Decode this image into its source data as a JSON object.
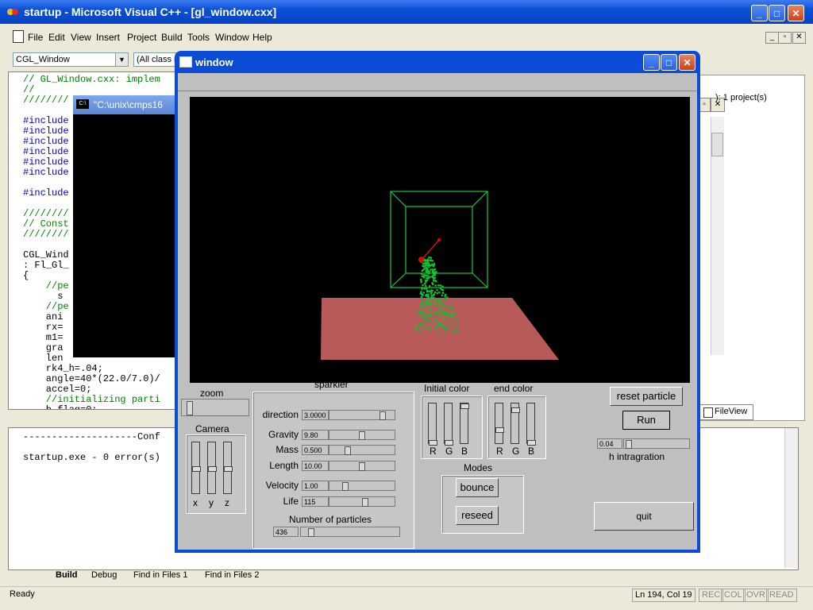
{
  "vc": {
    "title": "startup - Microsoft Visual C++ - [gl_window.cxx]",
    "menu": [
      "File",
      "Edit",
      "View",
      "Insert",
      "Project",
      "Build",
      "Tools",
      "Window",
      "Help"
    ],
    "class_combo": "CGL_Window",
    "member_combo": "(All class m",
    "code_lines": [
      {
        "text": "// GL_Window.cxx: implem",
        "color": "#008000"
      },
      {
        "text": "//",
        "color": "#008000"
      },
      {
        "text": "////////",
        "color": "#008000"
      },
      {
        "text": "",
        "color": "#000"
      },
      {
        "text": "#include",
        "color": "#0000c0"
      },
      {
        "text": "#include",
        "color": "#0000c0"
      },
      {
        "text": "#include",
        "color": "#0000c0"
      },
      {
        "text": "#include",
        "color": "#0000c0"
      },
      {
        "text": "#include",
        "color": "#0000c0"
      },
      {
        "text": "#include",
        "color": "#0000c0"
      },
      {
        "text": "",
        "color": "#000"
      },
      {
        "text": "#include",
        "color": "#0000c0"
      },
      {
        "text": "",
        "color": "#000"
      },
      {
        "text": "////////",
        "color": "#008000"
      },
      {
        "text": "// Const",
        "color": "#008000"
      },
      {
        "text": "////////",
        "color": "#008000"
      },
      {
        "text": "",
        "color": "#000"
      },
      {
        "text": "CGL_Wind",
        "color": "#000"
      },
      {
        "text": ": Fl_Gl_",
        "color": "#000"
      },
      {
        "text": "{",
        "color": "#000"
      },
      {
        "text": "    //pe",
        "color": "#008000"
      },
      {
        "text": "      s",
        "color": "#000"
      },
      {
        "text": "    //pe",
        "color": "#008000"
      },
      {
        "text": "    ani",
        "color": "#000"
      },
      {
        "text": "    rx=",
        "color": "#000"
      },
      {
        "text": "    m1=",
        "color": "#000"
      },
      {
        "text": "    gra",
        "color": "#000"
      },
      {
        "text": "    len",
        "color": "#000"
      },
      {
        "text": "    rk4_h=.04;",
        "color": "#000"
      },
      {
        "text": "    angle=40*(22.0/7.0)/",
        "color": "#000"
      },
      {
        "text": "    accel=0;",
        "color": "#000"
      },
      {
        "text": "    //initializing parti",
        "color": "#008000"
      },
      {
        "text": "    b_flag=0;",
        "color": "#000"
      }
    ],
    "console_title": "\"C:\\unix\\cmps16",
    "right_pane_text": "): 1 project(s)",
    "fileview_tab": "FileView",
    "output_lines": [
      "--------------------Conf",
      "",
      "startup.exe - 0 error(s)"
    ],
    "output_tabs": [
      "Build",
      "Debug",
      "Find in Files 1",
      "Find in Files 2"
    ],
    "status_left": "Ready",
    "status_pos": "Ln 194, Col 19",
    "status_flags": [
      "REC",
      "COL",
      "OVR",
      "READ"
    ]
  },
  "fl": {
    "title": "window",
    "zoom_label": "zoom",
    "camera_label": "Camera",
    "camera_axes": [
      "x",
      "y",
      "z"
    ],
    "sparkler_label": "sparkler",
    "params": [
      {
        "label": "direction",
        "value": "3.0000",
        "level": 0.85
      },
      {
        "label": "Gravity",
        "value": "9.80",
        "level": 0.5
      },
      {
        "label": "Mass",
        "value": "0.500",
        "level": 0.25
      },
      {
        "label": "Length",
        "value": "10.00",
        "level": 0.5
      },
      {
        "label": "Velocity",
        "value": "1.00",
        "level": 0.22
      },
      {
        "label": "Life",
        "value": "115",
        "level": 0.55
      }
    ],
    "particles_label": "Number of particles",
    "particles_value": "436",
    "particles_level": 0.08,
    "initial_color_label": "Initial color",
    "end_color_label": "end color",
    "rgb": [
      "R",
      "G",
      "B"
    ],
    "modes_label": "Modes",
    "bounce_label": "bounce",
    "reseed_label": "reseed",
    "reset_label": "reset particle",
    "run_label": "Run",
    "h_value": "0.04",
    "h_label": "h intragration",
    "quit_label": "quit",
    "colors": {
      "floor": "#b95a5a",
      "box": "#1ec83c",
      "particles": "#10c030",
      "emitter": "#d01010"
    }
  }
}
